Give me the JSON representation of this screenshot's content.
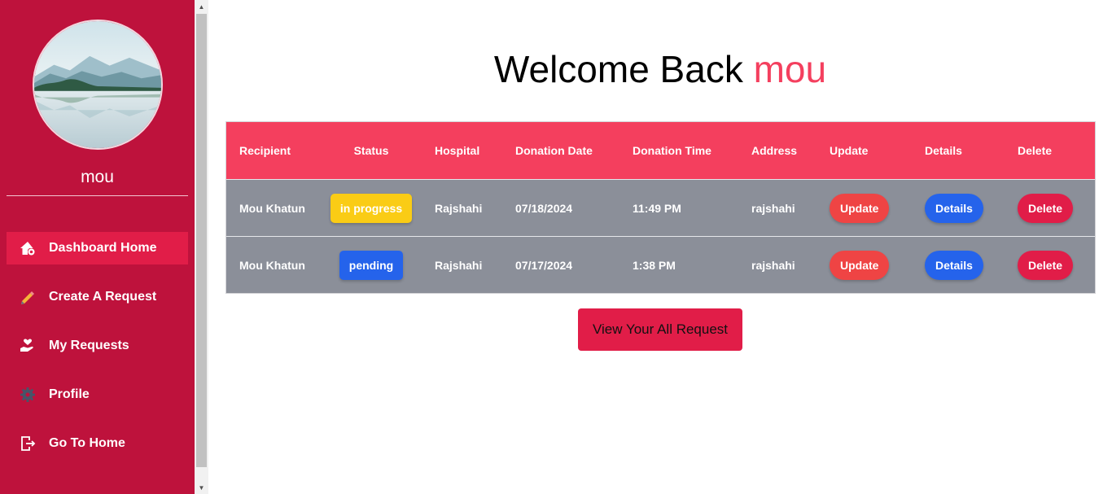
{
  "sidebar": {
    "username": "mou",
    "nav": [
      {
        "label": "Dashboard Home",
        "icon": "home-gear-icon",
        "active": true
      },
      {
        "label": "Create A Request",
        "icon": "pencil-icon",
        "active": false
      },
      {
        "label": "My Requests",
        "icon": "hand-heart-icon",
        "active": false
      },
      {
        "label": "Profile",
        "icon": "gear-icon",
        "active": false
      },
      {
        "label": "Go To Home",
        "icon": "sign-out-icon",
        "active": false
      }
    ]
  },
  "welcome": {
    "prefix": "Welcome Back ",
    "name": "mou"
  },
  "table": {
    "headers": [
      "Recipient",
      "Status",
      "Hospital",
      "Donation Date",
      "Donation Time",
      "Address",
      "Update",
      "Details",
      "Delete"
    ],
    "rows": [
      {
        "recipient": "Mou Khatun",
        "status": "in progress",
        "hospital": "Rajshahi",
        "date": "07/18/2024",
        "time": "11:49 PM",
        "address": "rajshahi",
        "update": "Update",
        "details": "Details",
        "delete": "Delete"
      },
      {
        "recipient": "Mou Khatun",
        "status": "pending",
        "hospital": "Rajshahi",
        "date": "07/17/2024",
        "time": "1:38 PM",
        "address": "rajshahi",
        "update": "Update",
        "details": "Details",
        "delete": "Delete"
      }
    ]
  },
  "view_all_label": "View Your All Request",
  "colors": {
    "sidebar": "#be123c",
    "active": "#e11d48",
    "header": "#f43f5e",
    "row": "#8b8f99",
    "accent_name": "#f43f5e",
    "in_progress": "#facc15",
    "pending": "#2563eb"
  }
}
